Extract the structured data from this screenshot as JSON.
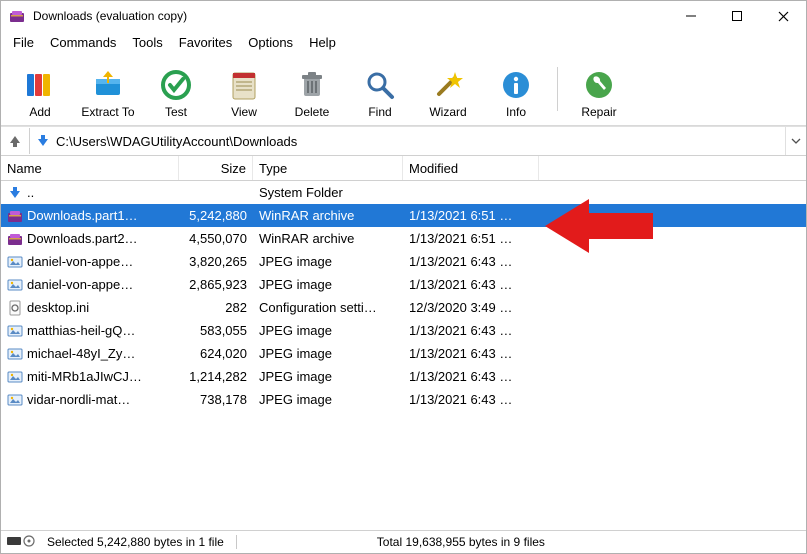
{
  "title": "Downloads (evaluation copy)",
  "menu": [
    "File",
    "Commands",
    "Tools",
    "Favorites",
    "Options",
    "Help"
  ],
  "toolbar": [
    {
      "label": "Add"
    },
    {
      "label": "Extract To"
    },
    {
      "label": "Test"
    },
    {
      "label": "View"
    },
    {
      "label": "Delete"
    },
    {
      "label": "Find"
    },
    {
      "label": "Wizard"
    },
    {
      "label": "Info"
    },
    {
      "label": "Repair"
    }
  ],
  "path": "C:\\Users\\WDAGUtilityAccount\\Downloads",
  "columns": {
    "name": "Name",
    "size": "Size",
    "type": "Type",
    "modified": "Modified"
  },
  "files": [
    {
      "name": "..",
      "size": "",
      "type": "System Folder",
      "modified": "",
      "icon": "up",
      "selected": false
    },
    {
      "name": "Downloads.part1…",
      "size": "5,242,880",
      "type": "WinRAR archive",
      "modified": "1/13/2021 6:51 …",
      "icon": "rar",
      "selected": true
    },
    {
      "name": "Downloads.part2…",
      "size": "4,550,070",
      "type": "WinRAR archive",
      "modified": "1/13/2021 6:51 …",
      "icon": "rar",
      "selected": false
    },
    {
      "name": "daniel-von-appe…",
      "size": "3,820,265",
      "type": "JPEG image",
      "modified": "1/13/2021 6:43 …",
      "icon": "img",
      "selected": false
    },
    {
      "name": "daniel-von-appe…",
      "size": "2,865,923",
      "type": "JPEG image",
      "modified": "1/13/2021 6:43 …",
      "icon": "img",
      "selected": false
    },
    {
      "name": "desktop.ini",
      "size": "282",
      "type": "Configuration setti…",
      "modified": "12/3/2020 3:49 …",
      "icon": "ini",
      "selected": false
    },
    {
      "name": "matthias-heil-gQ…",
      "size": "583,055",
      "type": "JPEG image",
      "modified": "1/13/2021 6:43 …",
      "icon": "img",
      "selected": false
    },
    {
      "name": "michael-48yI_Zy…",
      "size": "624,020",
      "type": "JPEG image",
      "modified": "1/13/2021 6:43 …",
      "icon": "img",
      "selected": false
    },
    {
      "name": "miti-MRb1aJIwCJ…",
      "size": "1,214,282",
      "type": "JPEG image",
      "modified": "1/13/2021 6:43 …",
      "icon": "img",
      "selected": false
    },
    {
      "name": "vidar-nordli-mat…",
      "size": "738,178",
      "type": "JPEG image",
      "modified": "1/13/2021 6:43 …",
      "icon": "img",
      "selected": false
    }
  ],
  "status": {
    "selected": "Selected 5,242,880 bytes in 1 file",
    "total": "Total 19,638,955 bytes in 9 files"
  }
}
